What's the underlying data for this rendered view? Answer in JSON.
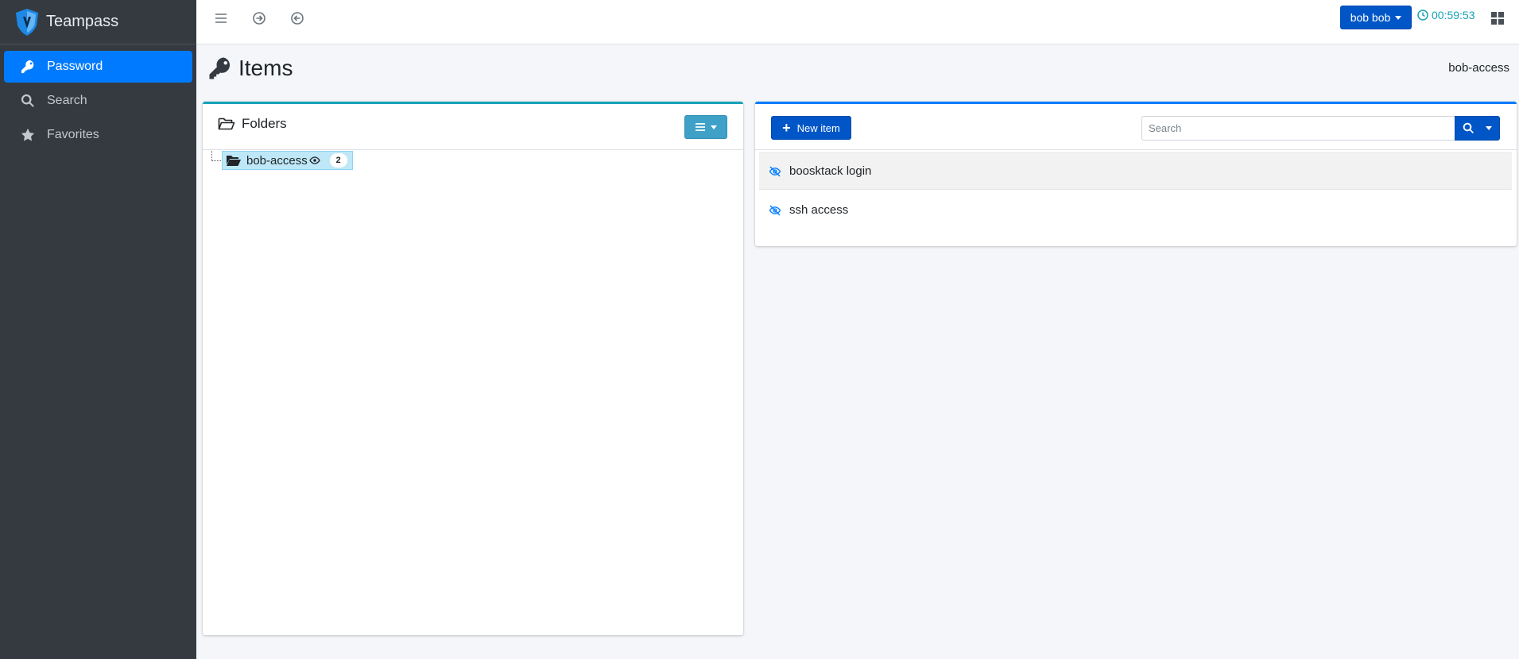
{
  "brand": {
    "name": "Teampass"
  },
  "sidebar": {
    "items": [
      {
        "label": "Password",
        "icon": "key-icon",
        "active": true
      },
      {
        "label": "Search",
        "icon": "search-icon",
        "active": false
      },
      {
        "label": "Favorites",
        "icon": "star-icon",
        "active": false
      }
    ]
  },
  "topbar": {
    "user_label": "bob bob",
    "timer": "00:59:53"
  },
  "page": {
    "title": "Items",
    "breadcrumb": "bob-access"
  },
  "folders": {
    "title": "Folders",
    "tree": [
      {
        "label": "bob-access",
        "count": "2"
      }
    ]
  },
  "items_panel": {
    "new_item_label": "New item",
    "search_placeholder": "Search",
    "items": [
      {
        "label": "boosktack login"
      },
      {
        "label": "ssh access"
      }
    ]
  },
  "colors": {
    "sidebar_bg": "#343a40",
    "accent": "#007bff",
    "button_primary": "#0056c7",
    "info": "#17a2b8"
  }
}
